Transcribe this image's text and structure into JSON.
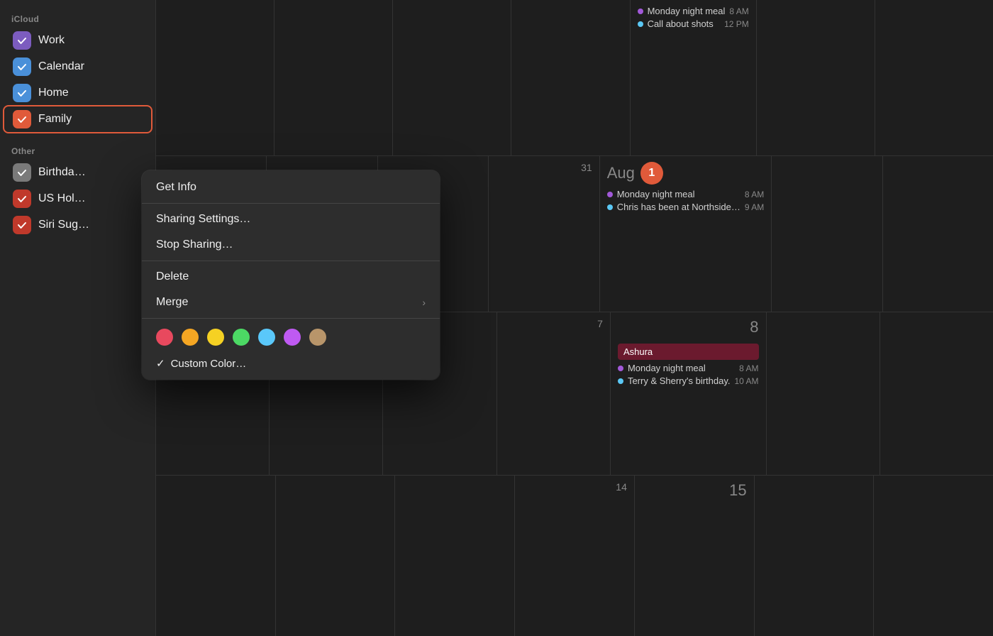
{
  "sidebar": {
    "icloud_label": "iCloud",
    "other_label": "Other",
    "items": [
      {
        "id": "work",
        "label": "Work",
        "color": "purple",
        "checked": true
      },
      {
        "id": "calendar",
        "label": "Calendar",
        "color": "blue",
        "checked": true
      },
      {
        "id": "home",
        "label": "Home",
        "color": "blue",
        "checked": true
      },
      {
        "id": "family",
        "label": "Family",
        "color": "red",
        "checked": true,
        "selected": true
      },
      {
        "id": "birthdays",
        "label": "Birthda…",
        "color": "gray",
        "checked": true
      },
      {
        "id": "us-holidays",
        "label": "US Hol…",
        "color": "dark-red",
        "checked": true
      },
      {
        "id": "siri-suggestions",
        "label": "Siri Sug…",
        "color": "dark-red",
        "checked": true
      }
    ]
  },
  "context_menu": {
    "get_info": "Get Info",
    "sharing_settings": "Sharing Settings…",
    "stop_sharing": "Stop Sharing…",
    "delete": "Delete",
    "merge": "Merge",
    "colors": [
      "#e8495e",
      "#f5a623",
      "#f5d123",
      "#4cd964",
      "#5ac8fa",
      "#bf5af2",
      "#b8956a"
    ],
    "custom_color": "Custom Color…",
    "custom_color_checked": true
  },
  "calendar": {
    "rows": [
      {
        "cells": [
          {
            "date": "",
            "events": []
          },
          {
            "date": "",
            "events": []
          },
          {
            "date": "",
            "events": []
          },
          {
            "date": "",
            "events": []
          },
          {
            "date": "",
            "events": [
              {
                "text": "Monday night meal",
                "time": "8 AM",
                "dot": "purple"
              },
              {
                "text": "Call about shots",
                "time": "12 PM",
                "dot": "blue"
              }
            ]
          },
          {
            "date": "",
            "events": []
          },
          {
            "date": "",
            "events": []
          }
        ]
      },
      {
        "cells": [
          {
            "date": "",
            "events": []
          },
          {
            "date": "",
            "events": []
          },
          {
            "date": "",
            "events": []
          },
          {
            "date": "31",
            "events": []
          },
          {
            "date": "aug1",
            "events": [
              {
                "text": "Monday night meal",
                "time": "8 AM",
                "dot": "purple"
              },
              {
                "text": "Chris has been at Northside…",
                "time": "9 AM",
                "dot": "blue"
              }
            ]
          },
          {
            "date": "",
            "events": []
          },
          {
            "date": "",
            "events": []
          }
        ]
      },
      {
        "cells": [
          {
            "date": "",
            "events": []
          },
          {
            "date": "",
            "events": []
          },
          {
            "date": "",
            "events": []
          },
          {
            "date": "7",
            "events": []
          },
          {
            "date": "8",
            "events": [
              {
                "text": "Ashura",
                "time": "",
                "dot": "",
                "type": "allday"
              },
              {
                "text": "Monday night meal",
                "time": "8 AM",
                "dot": "purple"
              },
              {
                "text": "Terry & Sherry's birthday.",
                "time": "10 AM",
                "dot": "blue"
              }
            ]
          },
          {
            "date": "",
            "events": []
          },
          {
            "date": "",
            "events": []
          }
        ]
      },
      {
        "cells": [
          {
            "date": "",
            "events": []
          },
          {
            "date": "",
            "events": []
          },
          {
            "date": "",
            "events": []
          },
          {
            "date": "14",
            "events": []
          },
          {
            "date": "15",
            "events": []
          },
          {
            "date": "",
            "events": []
          },
          {
            "date": "",
            "events": []
          }
        ]
      }
    ]
  }
}
